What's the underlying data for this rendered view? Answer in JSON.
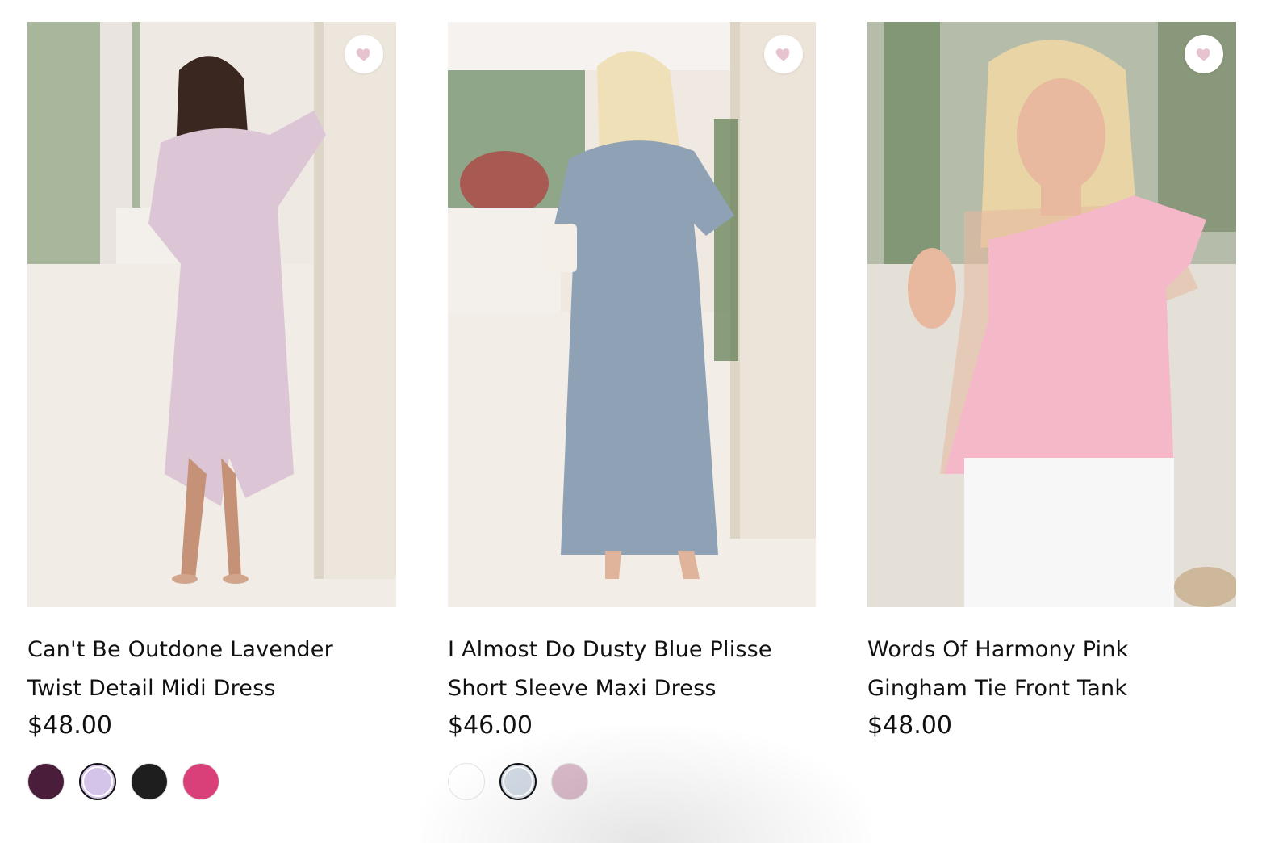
{
  "products": [
    {
      "title_line1": "Can't Be Outdone Lavender",
      "title_line2": "Twist Detail Midi Dress",
      "price": "$48.00",
      "wishlist_icon": "heart-icon",
      "photo_colors": {
        "dress": "#dcc6d6",
        "background": "#efe9e4",
        "pillar": "#ece6dc",
        "foliage": "#5c7a4a"
      },
      "swatches": [
        {
          "color": "#4a1d3b",
          "selected": false
        },
        {
          "color": "#d5c4ea",
          "selected": true
        },
        {
          "color": "#1e1e1e",
          "selected": false
        },
        {
          "color": "#d9407a",
          "selected": false
        }
      ]
    },
    {
      "title_line1": "I Almost Do Dusty Blue Plisse",
      "title_line2": "Short Sleeve Maxi Dress",
      "price": "$46.00",
      "wishlist_icon": "heart-icon",
      "photo_colors": {
        "dress": "#8fa1b5",
        "background": "#efe9e2",
        "pillar": "#ece4d8",
        "foliage": "#4e7a4e"
      },
      "swatches": [
        {
          "color": "#ffffff",
          "selected": false
        },
        {
          "color": "#d3dce6",
          "selected": true
        },
        {
          "color": "#dbbccb",
          "selected": false
        }
      ]
    },
    {
      "title_line1": "Words Of Harmony Pink",
      "title_line2": "Gingham Tie Front Tank",
      "price": "$48.00",
      "wishlist_icon": "heart-icon",
      "photo_colors": {
        "dress": "#f5b8c8",
        "background": "#dbd8cf",
        "pillar": "#a7b19a",
        "foliage": "#5f7e52"
      },
      "swatches": []
    }
  ],
  "accent_colors": {
    "heart": "#e6c3cf",
    "text": "#111111"
  }
}
